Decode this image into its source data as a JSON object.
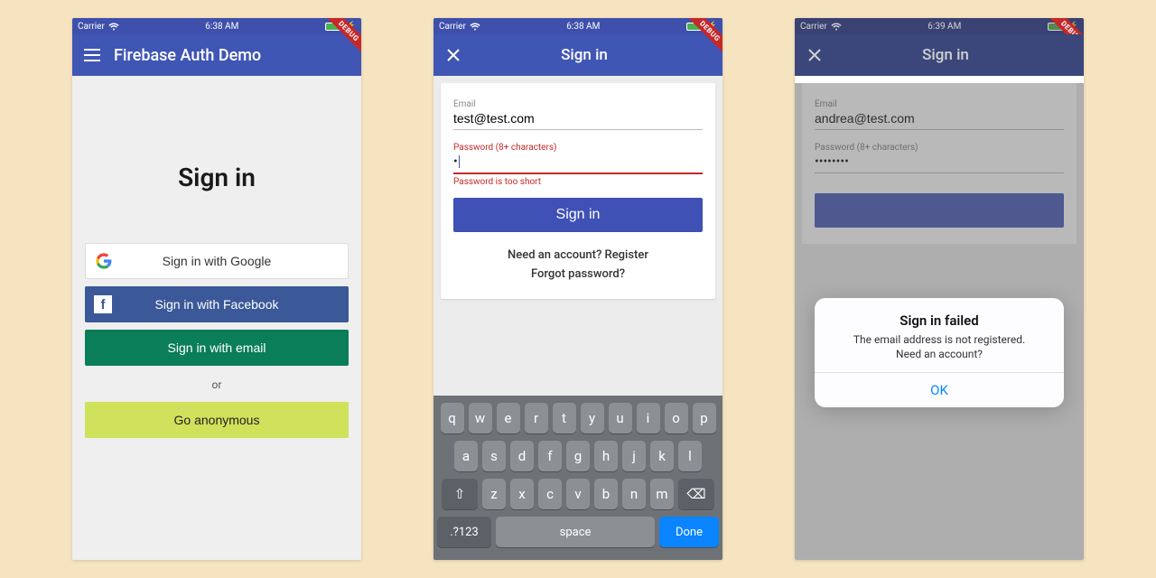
{
  "statusbar": {
    "carrier": "Carrier",
    "time1": "6:38 AM",
    "time2": "6:38 AM",
    "time3": "6:39 AM"
  },
  "debug_ribbon": "DEBUG",
  "screen1": {
    "title": "Firebase Auth Demo",
    "hero": "Sign in",
    "google": "Sign in with Google",
    "facebook": "Sign in with Facebook",
    "email": "Sign in with email",
    "or": "or",
    "anon": "Go anonymous"
  },
  "screen2": {
    "title": "Sign in",
    "email_label": "Email",
    "email_value": "test@test.com",
    "password_label": "Password (8+ characters)",
    "password_value": "•",
    "password_helper": "Password is too short",
    "submit": "Sign in",
    "register": "Need an account? Register",
    "forgot": "Forgot password?",
    "keyboard_rows": [
      [
        "q",
        "w",
        "e",
        "r",
        "t",
        "y",
        "u",
        "i",
        "o",
        "p"
      ],
      [
        "a",
        "s",
        "d",
        "f",
        "g",
        "h",
        "j",
        "k",
        "l"
      ],
      [
        "⇧",
        "z",
        "x",
        "c",
        "v",
        "b",
        "n",
        "m",
        "⌫"
      ]
    ],
    "key_sym": ".?123",
    "key_space": "space",
    "key_done": "Done"
  },
  "screen3": {
    "title": "Sign in",
    "email_label": "Email",
    "email_value": "andrea@test.com",
    "password_label": "Password (8+ characters)",
    "password_value": "••••••••",
    "alert_title": "Sign in failed",
    "alert_msg1": "The email address is not registered.",
    "alert_msg2": "Need an account?",
    "alert_ok": "OK"
  }
}
